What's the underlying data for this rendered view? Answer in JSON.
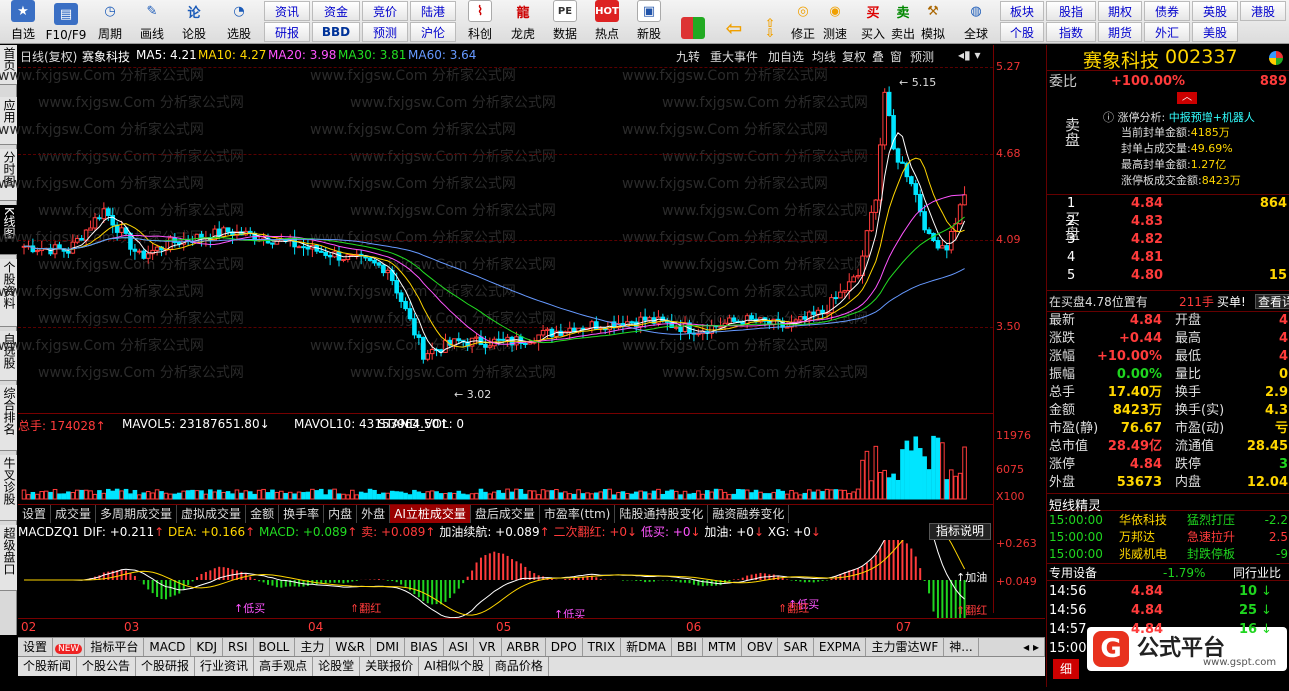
{
  "toolbar": {
    "buttons": [
      "自选",
      "F10/F9",
      "周期",
      "画线",
      "论股",
      "选股",
      "科创",
      "龙虎",
      "数据",
      "热点",
      "新股",
      "修正",
      "测速",
      "买入",
      "卖出",
      "模拟",
      "全球"
    ],
    "grid_top": [
      "资讯",
      "资金",
      "竞价",
      "陆港",
      "板块",
      "股指",
      "期权",
      "债券",
      "英股",
      "港股"
    ],
    "grid_bot": [
      "研报",
      "BBD",
      "预测",
      "沪伦",
      "个股",
      "指数",
      "期货",
      "外汇",
      "美股"
    ]
  },
  "left_tabs": [
    "首页",
    "应用",
    "分时图",
    "K线图",
    "个股资料",
    "自选股",
    "综合排名",
    "牛叉诊股",
    "超级盘口"
  ],
  "chart_header": {
    "period": "日线(复权)",
    "name": "赛象科技",
    "ma5": "MA5: 4.21",
    "ma10": "MA10: 4.27",
    "ma20": "MA20: 3.98",
    "ma30": "MA30: 3.81",
    "ma60": "MA60: 3.64",
    "tools": [
      "九转",
      "重大事件",
      "加自选",
      "均线",
      "复权",
      "叠",
      "窗",
      "预测"
    ]
  },
  "price_axis": [
    "5.27",
    "4.68",
    "4.09",
    "3.50"
  ],
  "price_marks": {
    "high": "5.15",
    "low": "3.02"
  },
  "volume_header": {
    "total": "总手: 174028",
    "mavol5": "MAVOL5: 23187651.80",
    "mavol10": "MAVOL10: 43153964.50",
    "stand": "STAND_VOL: 0"
  },
  "volume_axis": [
    "11976",
    "6075",
    "X100"
  ],
  "volume_tabs": [
    "设置",
    "成交量",
    "多周期成交量",
    "虚拟成交量",
    "金额",
    "换手率",
    "内盘",
    "外盘",
    "AI立桩成交量",
    "盘后成交量",
    "市盈率(ttm)",
    "陆股通持股变化",
    "融资融券变化"
  ],
  "macd_header": {
    "name": "MACDZQ1",
    "dif": "DIF: +0.211",
    "dea": "DEA: +0.166",
    "macd": "MACD: +0.089",
    "sell": "卖: +0.089",
    "jiayou": "加油续航: +0.089",
    "erci": "二次翻红: +0",
    "dimai": "低买: +0",
    "jy": "加油: +0",
    "xg": "XG: +0",
    "explain": "指标说明"
  },
  "macd_axis": [
    "+0.263",
    "+0.049"
  ],
  "macd_signals": {
    "low_buy": "低买",
    "turn_red": "翻红",
    "jiayou": "加油"
  },
  "date_axis": [
    "02",
    "03",
    "04",
    "05",
    "06",
    "07"
  ],
  "bottom_tabs": [
    "设置",
    "NEW",
    "指标平台",
    "MACD",
    "KDJ",
    "RSI",
    "BOLL",
    "主力",
    "W&R",
    "DMI",
    "BIAS",
    "ASI",
    "VR",
    "ARBR",
    "DPO",
    "TRIX",
    "新DMA",
    "BBI",
    "MTM",
    "OBV",
    "SAR",
    "EXPMA",
    "主力雷达WF",
    "神..."
  ],
  "bottom_links": [
    "个股新闻",
    "个股公告",
    "个股研报",
    "行业资讯",
    "高手观点",
    "论股堂",
    "关联报价",
    "AI相似个股",
    "商品价格"
  ],
  "quote": {
    "title": "赛象科技",
    "code": "002337",
    "weibi_label": "委比",
    "weibi": "+100.00%",
    "weibi_vol": "889",
    "zt_label": "涨停分析:",
    "zt_val": "中报预增+机器人",
    "zt_lines": [
      {
        "k": "当前封单金额:",
        "v": "4185万"
      },
      {
        "k": "封单占成交量:",
        "v": "49.69%"
      },
      {
        "k": "最高封单金额:",
        "v": "1.27亿"
      },
      {
        "k": "涨停板成交金额:",
        "v": "8423万"
      }
    ],
    "sell_label": "卖盘",
    "buy_label": "买盘",
    "bids": [
      {
        "n": "1",
        "p": "4.84",
        "v": "864"
      },
      {
        "n": "2",
        "p": "4.83",
        "v": ""
      },
      {
        "n": "3",
        "p": "4.82",
        "v": ""
      },
      {
        "n": "4",
        "p": "4.81",
        "v": ""
      },
      {
        "n": "5",
        "p": "4.80",
        "v": "15"
      }
    ],
    "buy_note": "在买盘4.78位置有",
    "buy_note_vol": "211手",
    "buy_note_tag": "买单!",
    "buy_note_link": "查看详",
    "stats": [
      {
        "k1": "最新",
        "v1": "4.84",
        "k2": "开盘",
        "v2": "4"
      },
      {
        "k1": "涨跌",
        "v1": "+0.44",
        "k2": "最高",
        "v2": "4"
      },
      {
        "k1": "涨幅",
        "v1": "+10.00%",
        "k2": "最低",
        "v2": "4"
      },
      {
        "k1": "振幅",
        "v1": "0.00%",
        "k2": "量比",
        "v2": "0"
      },
      {
        "k1": "总手",
        "v1": "17.40万",
        "k2": "换手",
        "v2": "2.9"
      },
      {
        "k1": "金额",
        "v1": "8423万",
        "k2": "换手(实)",
        "v2": "4.3"
      },
      {
        "k1": "市盈(静)",
        "v1": "76.67",
        "k2": "市盈(动)",
        "v2": "亏"
      },
      {
        "k1": "总市值",
        "v1": "28.49亿",
        "k2": "流通值",
        "v2": "28.45"
      },
      {
        "k1": "涨停",
        "v1": "4.84",
        "k2": "跌停",
        "v2": "3"
      },
      {
        "k1": "外盘",
        "v1": "53673",
        "k2": "内盘",
        "v2": "12.04"
      }
    ],
    "short_title": "短线精灵",
    "short_rows": [
      {
        "t": "15:00:00",
        "s": "华依科技",
        "e": "猛烈打压",
        "v": "-2.2"
      },
      {
        "t": "15:00:00",
        "s": "万邦达",
        "e": "急速拉升",
        "v": "2.5"
      },
      {
        "t": "15:00:00",
        "s": "兆威机电",
        "e": "封跌停板",
        "v": "-9"
      }
    ],
    "special_label": "专用设备",
    "special_val": "-1.79%",
    "special_link": "同行业比",
    "ticks": [
      {
        "t": "14:56",
        "p": "4.84",
        "v": "10"
      },
      {
        "t": "14:56",
        "p": "4.84",
        "v": "25"
      },
      {
        "t": "14:57",
        "p": "4.84",
        "v": "16"
      },
      {
        "t": "15:00",
        "p": "",
        "v": ""
      }
    ],
    "logo": "公式平台",
    "logo_url": "www.gspt.com",
    "tab_small": "细"
  },
  "colors": {
    "up": "#ff3b3b",
    "down": "#00e5ff",
    "ma5": "#ffffff",
    "ma10": "#ffd600",
    "ma20": "#ff55ff",
    "ma30": "#22dd22",
    "ma60": "#6699ff"
  }
}
